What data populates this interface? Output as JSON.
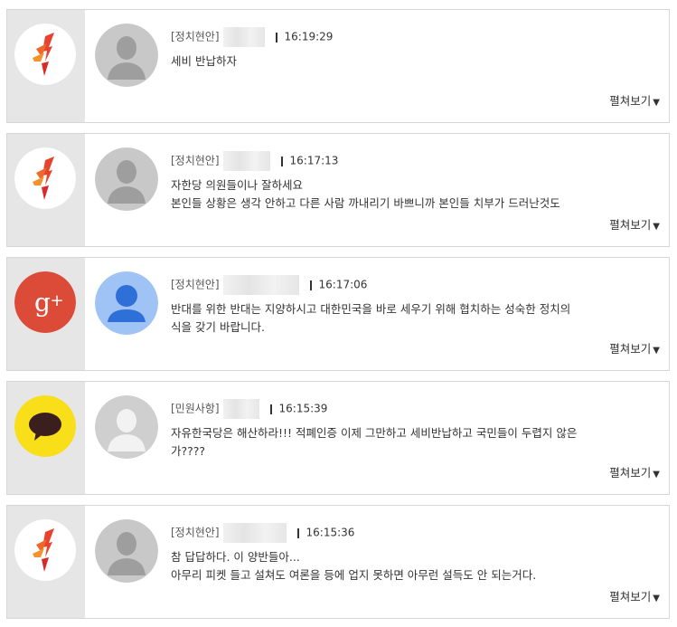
{
  "comments": [
    {
      "badge": "party-logo",
      "avatar": "default-avatar",
      "category": "[정치현안]",
      "time": "16:19:29",
      "lines": [
        "세비 반납하자"
      ],
      "more_label": "펼쳐보기",
      "more_arrow": "▼"
    },
    {
      "badge": "party-logo",
      "avatar": "default-avatar",
      "category": "[정치현안]",
      "time": "16:17:13",
      "lines": [
        "자한당 의원들이나 잘하세요",
        "본인들 상황은 생각 안하고 다른 사람 까내리기 바쁘니까 본인들 치부가 드러난것도"
      ],
      "more_label": "펼쳐보기",
      "more_arrow": "▼"
    },
    {
      "badge": "google-plus-logo",
      "avatar": "google-avatar",
      "category": "[정치현안]",
      "time": "16:17:06",
      "lines": [
        "반대를 위한 반대는 지양하시고 대한민국을 바로 세우기 위해 협치하는 성숙한 정치의",
        "식을 갖기 바랍니다."
      ],
      "more_label": "펼쳐보기",
      "more_arrow": "▼"
    },
    {
      "badge": "kakao-logo",
      "avatar": "default-avatar-light",
      "category": "[민원사항]",
      "time": "16:15:39",
      "lines": [
        "자유한국당은 해산하라!!! 적폐인증 이제 그만하고 세비반납하고 국민들이 두렵지 않은",
        "가????"
      ],
      "more_label": "펼쳐보기",
      "more_arrow": "▼"
    },
    {
      "badge": "party-logo",
      "avatar": "default-avatar",
      "category": "[정치현안]",
      "time": "16:15:36",
      "lines": [
        "참 답답하다. 이 양반들아...",
        "아무리 피켓 들고 설쳐도 여론을 등에 업지 못하면 아무런 설득도 안 되는거다."
      ],
      "more_label": "펼쳐보기",
      "more_arrow": "▼"
    }
  ]
}
